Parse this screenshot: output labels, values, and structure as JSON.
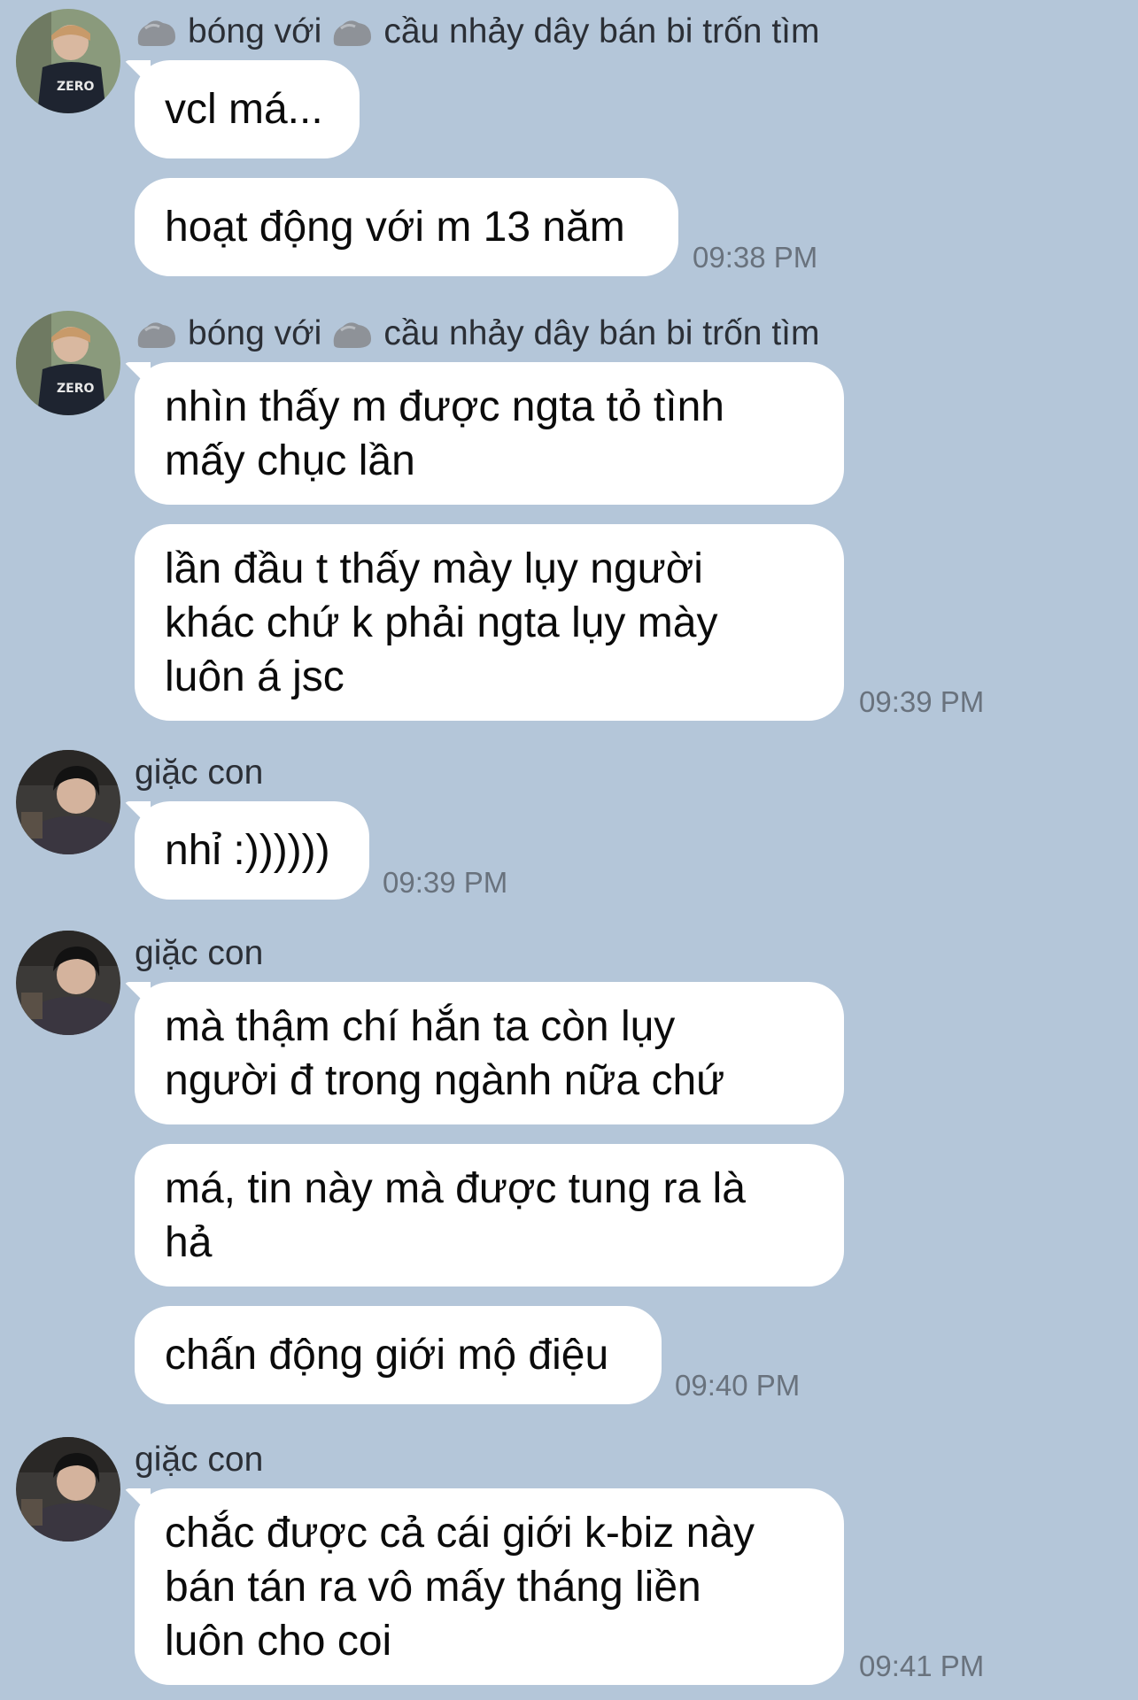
{
  "colors": {
    "background": "#b4c6d9",
    "bubble": "#ffffff",
    "text": "#0b0b0b",
    "timestamp": "#69727d"
  },
  "groups": [
    {
      "sender": {
        "part1": "bóng với",
        "part2": "cầu nhảy dây bán bi trốn tìm",
        "icon": "rock-icon"
      },
      "messages": [
        "vcl má...",
        "hoạt động với m 13 năm"
      ],
      "time": "09:38 PM"
    },
    {
      "sender": {
        "part1": "bóng với",
        "part2": "cầu nhảy dây bán bi trốn tìm",
        "icon": "rock-icon"
      },
      "messages": [
        "nhìn thấy m được ngta tỏ tình\nmấy chục lần",
        "lần đầu t thấy mày lụy người\nkhác chứ k phải ngta lụy mày\nluôn á jsc"
      ],
      "time": "09:39 PM"
    },
    {
      "sender": {
        "name": "giặc con"
      },
      "messages": [
        "nhỉ :))))))"
      ],
      "time": "09:39 PM"
    },
    {
      "sender": {
        "name": "giặc con"
      },
      "messages": [
        "mà thậm chí hắn ta còn lụy\nngười đ trong ngành nữa chứ",
        "má, tin này mà được tung ra là\nhả",
        "chấn động giới mộ điệu"
      ],
      "time": "09:40 PM"
    },
    {
      "sender": {
        "name": "giặc con"
      },
      "messages": [
        "chắc được cả cái giới k-biz này\nbán tán ra vô mấy tháng liền\nluôn cho coi"
      ],
      "time": "09:41 PM"
    }
  ]
}
